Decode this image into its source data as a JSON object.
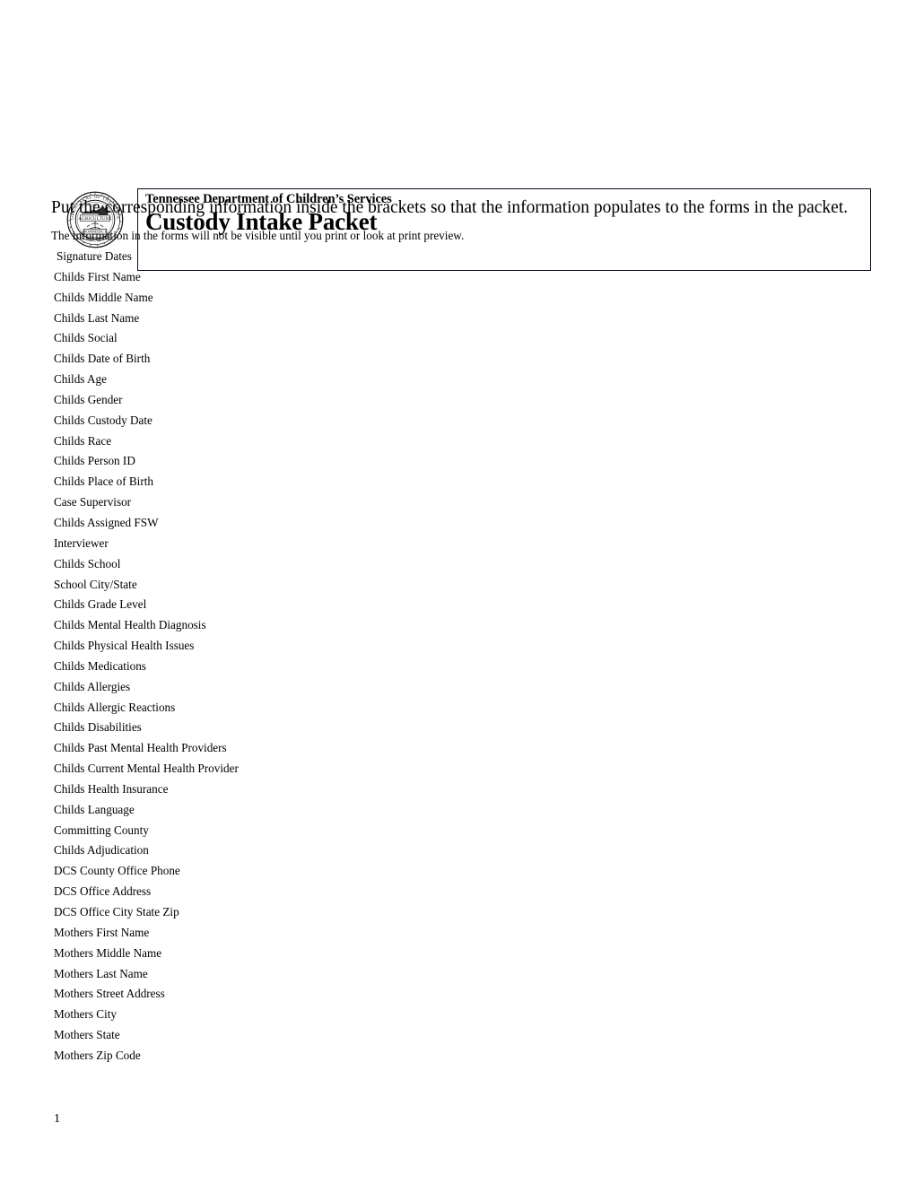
{
  "document": {
    "header": {
      "seal_icon": "tennessee-state-seal-icon",
      "seal_text": {
        "outer_top": "GREAT SEAL OF THE STATE OF TENNESSEE",
        "inner_upper": "XVI",
        "band_upper": "AGRICULTURE",
        "band_lower": "COMMERCE",
        "year": "1796"
      },
      "department": "Tennessee Department of Children’s Services",
      "title": "Custody Intake Packet"
    },
    "instructions": {
      "main": "Put the corresponding information inside the brackets so that the information populates to the forms in the packet.",
      "note": "The information in the forms will not be visible until you print or look at print preview."
    },
    "fields": [
      "Signature Dates",
      "Childs First Name",
      "Childs Middle Name",
      "Childs Last Name",
      "Childs Social",
      "Childs Date of Birth",
      "Childs Age",
      "Childs Gender",
      "Childs Custody Date",
      "Childs Race",
      "Childs Person ID",
      "Childs Place of Birth",
      "Case Supervisor",
      "Childs Assigned FSW",
      "Interviewer",
      "Childs School",
      "School City/State",
      "Childs Grade Level",
      "Childs Mental Health Diagnosis",
      "Childs Physical Health Issues",
      "Childs Medications",
      "Childs Allergies",
      "Childs Allergic Reactions",
      "Childs Disabilities",
      "Childs Past Mental Health Providers",
      "Childs Current Mental Health Provider",
      "Childs Health Insurance",
      "Childs Language",
      "Committing County",
      "Childs Adjudication",
      "DCS County Office Phone",
      "DCS Office Address",
      "DCS Office City State Zip",
      "Mothers First Name",
      "Mothers Middle Name",
      "Mothers Last Name",
      "Mothers Street Address",
      "Mothers City",
      "Mothers State",
      "Mothers Zip Code"
    ],
    "footer": {
      "page_number": "1"
    },
    "colors": {
      "text": "#000000",
      "border": "#0a0a1e",
      "background": "#ffffff"
    }
  }
}
